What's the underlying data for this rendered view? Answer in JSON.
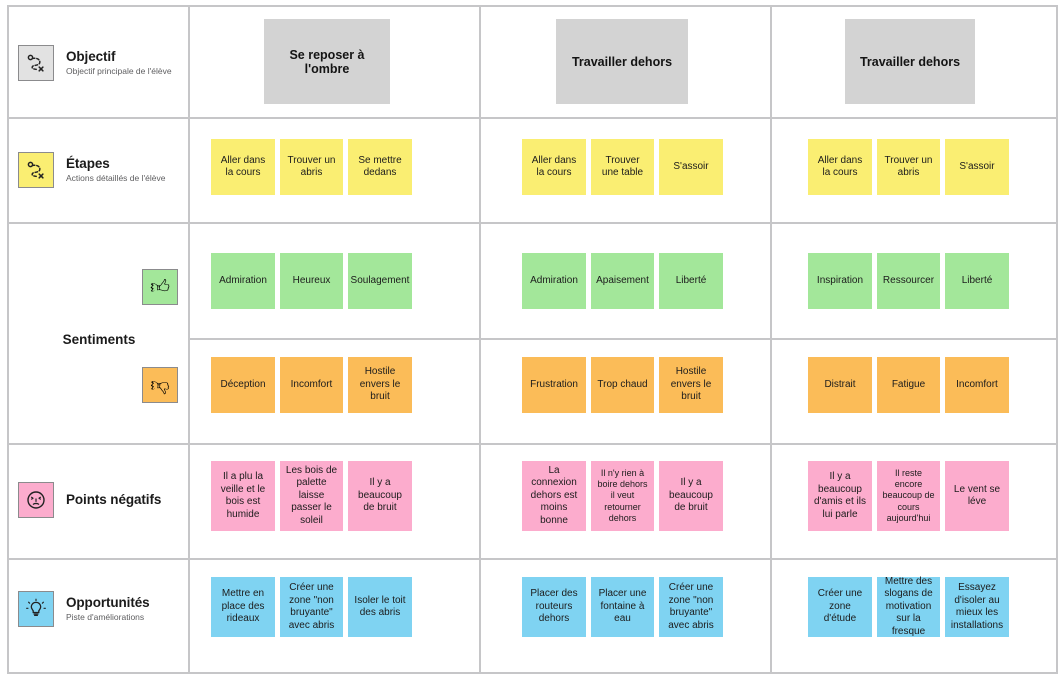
{
  "rows": [
    {
      "id": "objectif",
      "title": "Objectif",
      "subtitle": "Objectif principale de l'élève",
      "icon": "route-goal-icon",
      "icon_color": "#e2e2e2"
    },
    {
      "id": "etapes",
      "title": "Étapes",
      "subtitle": "Actions détaillés de l'élève",
      "icon": "route-goal-icon",
      "icon_color": "#faee72"
    },
    {
      "id": "sentiments",
      "title": "Sentiments",
      "subtitle": "",
      "icon_positive": "thumbs-up-icon",
      "icon_negative": "thumbs-down-icon",
      "icon_positive_color": "#a3e79a",
      "icon_negative_color": "#fbbc58"
    },
    {
      "id": "points-negatifs",
      "title": "Points négatifs",
      "subtitle": "",
      "icon": "sad-face-icon",
      "icon_color": "#fcaccd"
    },
    {
      "id": "opportunites",
      "title": "Opportunités",
      "subtitle": "Piste d'améliorations",
      "icon": "lightbulb-icon",
      "icon_color": "#7fd3f2"
    }
  ],
  "columns": [
    {
      "goal": "Se reposer à l'ombre"
    },
    {
      "goal": "Travailler dehors"
    },
    {
      "goal": "Travailler dehors"
    }
  ],
  "etapes": [
    [
      "Aller dans la cours",
      "Trouver un abris",
      "Se mettre dedans"
    ],
    [
      "Aller dans la cours",
      "Trouver une table",
      "S'assoir"
    ],
    [
      "Aller dans la cours",
      "Trouver un abris",
      "S'assoir"
    ]
  ],
  "sentiments_positifs": [
    [
      "Admiration",
      "Heureux",
      "Soulagement"
    ],
    [
      "Admiration",
      "Apaisement",
      "Liberté"
    ],
    [
      "Inspiration",
      "Ressourcer",
      "Liberté"
    ]
  ],
  "sentiments_negatifs": [
    [
      "Déception",
      "Incomfort",
      "Hostile envers le bruit"
    ],
    [
      "Frustration",
      "Trop chaud",
      "Hostile envers le bruit"
    ],
    [
      "Distrait",
      "Fatigue",
      "Incomfort"
    ]
  ],
  "points_negatifs": [
    [
      "Il a plu la veille et le bois est humide",
      "Les bois de palette laisse passer le soleil",
      "Il y a beaucoup de bruit"
    ],
    [
      "La connexion dehors est moins bonne",
      "Il n'y rien à boire dehors il veut retourner dehors",
      "Il y a beaucoup de bruit"
    ],
    [
      "Il y a beaucoup d'amis et ils lui parle",
      "Il reste encore beaucoup de cours aujourd'hui",
      "Le vent se léve"
    ]
  ],
  "opportunites": [
    [
      "Mettre en place des rideaux",
      "Créer une zone \"non bruyante\" avec abris",
      "Isoler le toit des abris"
    ],
    [
      "Placer des routeurs dehors",
      "Placer une fontaine à eau",
      "Créer une zone \"non bruyante\" avec abris"
    ],
    [
      "Créer une zone d'étude",
      "Mettre des slogans de motivation sur la fresque",
      "Essayez d'isoler au mieux les installations"
    ]
  ],
  "colors": {
    "goal": "#d3d3d3",
    "etapes": "#faee72",
    "positif": "#a3e79a",
    "negatif": "#fbbc58",
    "points": "#fcaccd",
    "opportunites": "#7fd3f2",
    "grid": "#c6c6c8"
  }
}
